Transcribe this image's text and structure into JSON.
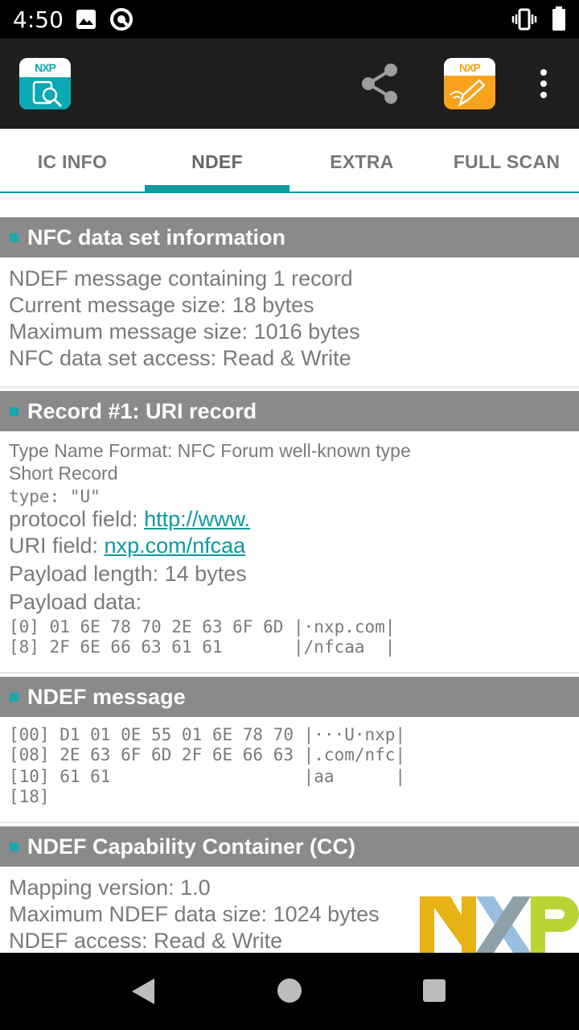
{
  "status_bar": {
    "time": "4:50"
  },
  "app_bar": {
    "logo_text": "NXP",
    "write_logo_text": "NXP"
  },
  "tabs": [
    {
      "label": "IC INFO"
    },
    {
      "label": "NDEF"
    },
    {
      "label": "EXTRA"
    },
    {
      "label": "FULL SCAN"
    }
  ],
  "active_tab": "NDEF",
  "nfc_info": {
    "title": "NFC data set information",
    "lines": [
      "NDEF message containing 1 record",
      "Current message size: 18 bytes",
      "Maximum message size: 1016 bytes",
      "NFC data set access: Read & Write"
    ]
  },
  "record1": {
    "title": "Record #1: URI record",
    "tnf": "Type Name Format: NFC Forum well-known type",
    "short_record": "Short Record",
    "type": "type: \"U\"",
    "protocol_label": "protocol field: ",
    "protocol_value": "http://www.",
    "uri_label": "URI field: ",
    "uri_value": "nxp.com/nfcaa",
    "payload_length": "Payload length: 14 bytes",
    "payload_data_label": "Payload data:",
    "hex_lines": [
      "[0] 01 6E 78 70 2E 63 6F 6D |·nxp.com|",
      "[8] 2F 6E 66 63 61 61       |/nfcaa  |"
    ]
  },
  "ndef_message": {
    "title": "NDEF message",
    "hex_lines": [
      "[00] D1 01 0E 55 01 6E 78 70 |···U·nxp|",
      "[08] 2E 63 6F 6D 2F 6E 66 63 |.com/nfc|",
      "[10] 61 61                   |aa      |",
      "[18]"
    ]
  },
  "cc": {
    "title": "NDEF Capability Container (CC)",
    "lines": [
      "Mapping version: 1.0",
      "Maximum NDEF data size: 1024 bytes",
      "NDEF access: Read & Write"
    ]
  },
  "colors": {
    "accent": "#0a9aa0",
    "header_bg": "#8a8a8a",
    "appbar_bg": "#1e1e1e",
    "write_logo": "#f9a21b"
  }
}
